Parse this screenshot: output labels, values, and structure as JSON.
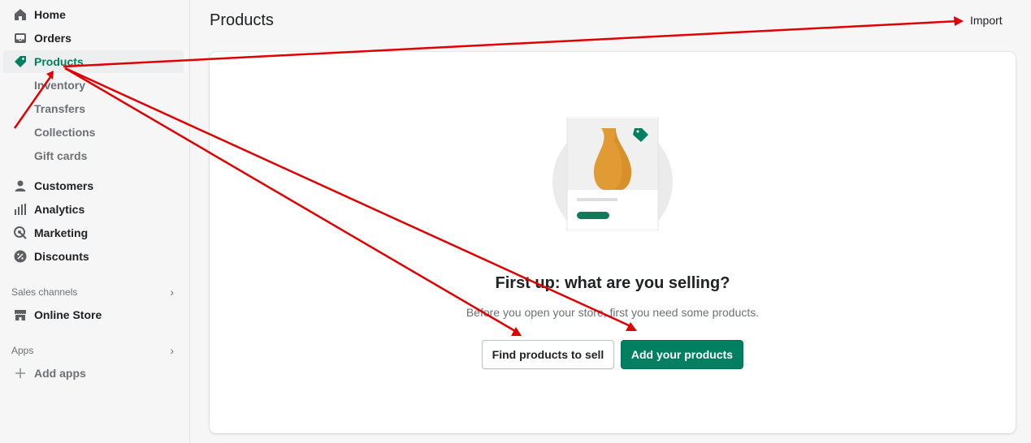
{
  "sidebar": {
    "items": [
      {
        "label": "Home",
        "icon": "home-icon"
      },
      {
        "label": "Orders",
        "icon": "inbox-icon"
      },
      {
        "label": "Products",
        "icon": "tag-icon",
        "active": true
      },
      {
        "label": "Customers",
        "icon": "person-icon"
      },
      {
        "label": "Analytics",
        "icon": "bar-chart-icon"
      },
      {
        "label": "Marketing",
        "icon": "target-icon"
      },
      {
        "label": "Discounts",
        "icon": "discount-icon"
      }
    ],
    "product_subitems": [
      "Inventory",
      "Transfers",
      "Collections",
      "Gift cards"
    ],
    "sales_channels_label": "Sales channels",
    "online_store_label": "Online Store",
    "apps_label": "Apps",
    "add_apps_label": "Add apps"
  },
  "header": {
    "title": "Products",
    "import_label": "Import"
  },
  "empty_state": {
    "heading": "First up: what are you selling?",
    "text": "Before you open your store, first you need some products.",
    "secondary_button": "Find products to sell",
    "primary_button": "Add your products"
  },
  "colors": {
    "accent": "#008060",
    "annotation": "#e00000"
  }
}
